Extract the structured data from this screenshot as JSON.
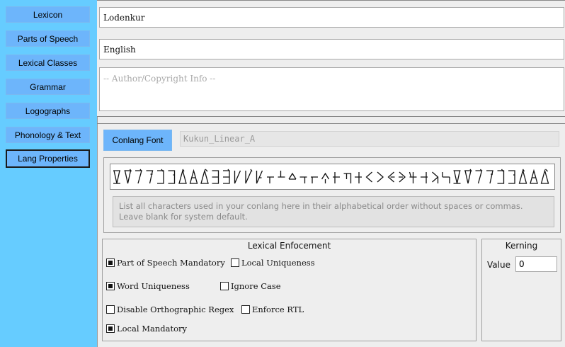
{
  "sidebar": {
    "items": [
      {
        "label": "Lexicon"
      },
      {
        "label": "Parts of Speech"
      },
      {
        "label": "Lexical Classes"
      },
      {
        "label": "Grammar"
      },
      {
        "label": "Logographs"
      },
      {
        "label": "Phonology & Text"
      },
      {
        "label": "Lang Properties",
        "active": true
      }
    ]
  },
  "properties": {
    "conlang_name": "Lodenkur",
    "local_language": "English",
    "author_placeholder": "-- Author/Copyright Info --"
  },
  "font": {
    "button_label": "Conlang Font",
    "font_name": "Kukun_Linear_A"
  },
  "alphabet": {
    "glyph_icon": "linear-a-glyph-icon",
    "hint": "List all characters used in your conlang here in their alphabetical order without spaces or commas. Leave blank for system default."
  },
  "lexical_enforcement": {
    "title": "Lexical Enfocement",
    "options": {
      "pos_mandatory": {
        "label": "Part of Speech Mandatory",
        "checked": true
      },
      "local_uniqueness": {
        "label": "Local Uniqueness",
        "checked": false
      },
      "word_uniqueness": {
        "label": "Word Uniqueness",
        "checked": true
      },
      "ignore_case": {
        "label": "Ignore Case",
        "checked": false
      },
      "disable_regex": {
        "label": "Disable Orthographic Regex",
        "checked": false
      },
      "enforce_rtl": {
        "label": "Enforce RTL",
        "checked": false
      },
      "local_mandatory": {
        "label": "Local Mandatory",
        "checked": true
      }
    }
  },
  "kerning": {
    "title": "Kerning",
    "value_label": "Value",
    "value": "0"
  },
  "colors": {
    "sidebar_bg": "#66ccff",
    "button_bg": "#6db5fb"
  }
}
